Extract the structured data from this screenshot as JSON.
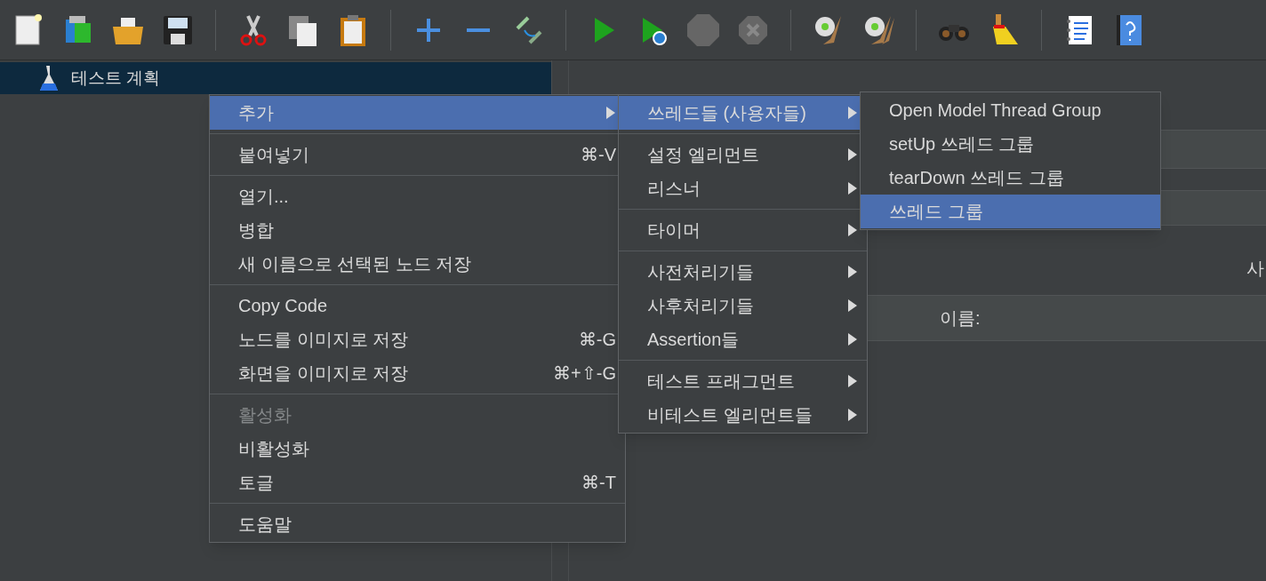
{
  "tree": {
    "items": [
      {
        "label": "테스트 계획",
        "selected": true
      }
    ]
  },
  "panel": {
    "side_label": "사",
    "name_label": "이름:"
  },
  "context_menu": {
    "groups": [
      [
        {
          "label": "추가",
          "submenu": true,
          "selected": true,
          "disabled": false
        }
      ],
      [
        {
          "label": "붙여넣기",
          "shortcut": "⌘-V",
          "submenu": false,
          "selected": false,
          "disabled": false
        }
      ],
      [
        {
          "label": "열기...",
          "submenu": false,
          "selected": false,
          "disabled": false
        },
        {
          "label": "병합",
          "submenu": false,
          "selected": false,
          "disabled": false
        },
        {
          "label": "새 이름으로 선택된 노드 저장",
          "submenu": false,
          "selected": false,
          "disabled": false
        }
      ],
      [
        {
          "label": "Copy Code",
          "submenu": false,
          "selected": false,
          "disabled": false
        },
        {
          "label": "노드를 이미지로 저장",
          "shortcut": "⌘-G",
          "submenu": false,
          "selected": false,
          "disabled": false
        },
        {
          "label": "화면을 이미지로 저장",
          "shortcut": "⌘+⇧-G",
          "submenu": false,
          "selected": false,
          "disabled": false
        }
      ],
      [
        {
          "label": "활성화",
          "submenu": false,
          "selected": false,
          "disabled": true
        },
        {
          "label": "비활성화",
          "submenu": false,
          "selected": false,
          "disabled": false
        },
        {
          "label": "토글",
          "shortcut": "⌘-T",
          "submenu": false,
          "selected": false,
          "disabled": false
        }
      ],
      [
        {
          "label": "도움말",
          "submenu": false,
          "selected": false,
          "disabled": false
        }
      ]
    ]
  },
  "add_submenu": {
    "groups": [
      [
        {
          "label": "쓰레드들 (사용자들)",
          "submenu": true,
          "selected": true,
          "disabled": false
        }
      ],
      [
        {
          "label": "설정 엘리먼트",
          "submenu": true,
          "selected": false,
          "disabled": false
        },
        {
          "label": "리스너",
          "submenu": true,
          "selected": false,
          "disabled": false
        }
      ],
      [
        {
          "label": "타이머",
          "submenu": true,
          "selected": false,
          "disabled": false
        }
      ],
      [
        {
          "label": "사전처리기들",
          "submenu": true,
          "selected": false,
          "disabled": false
        },
        {
          "label": "사후처리기들",
          "submenu": true,
          "selected": false,
          "disabled": false
        },
        {
          "label": "Assertion들",
          "submenu": true,
          "selected": false,
          "disabled": false
        }
      ],
      [
        {
          "label": "테스트 프래그먼트",
          "submenu": true,
          "selected": false,
          "disabled": false
        },
        {
          "label": "비테스트 엘리먼트들",
          "submenu": true,
          "selected": false,
          "disabled": false
        }
      ]
    ]
  },
  "threads_submenu": {
    "groups": [
      [
        {
          "label": "Open Model Thread Group",
          "submenu": false,
          "selected": false,
          "disabled": false
        },
        {
          "label": "setUp 쓰레드 그룹",
          "submenu": false,
          "selected": false,
          "disabled": false
        },
        {
          "label": "tearDown 쓰레드 그룹",
          "submenu": false,
          "selected": false,
          "disabled": false
        },
        {
          "label": "쓰레드 그룹",
          "submenu": false,
          "selected": true,
          "disabled": false
        }
      ]
    ]
  }
}
